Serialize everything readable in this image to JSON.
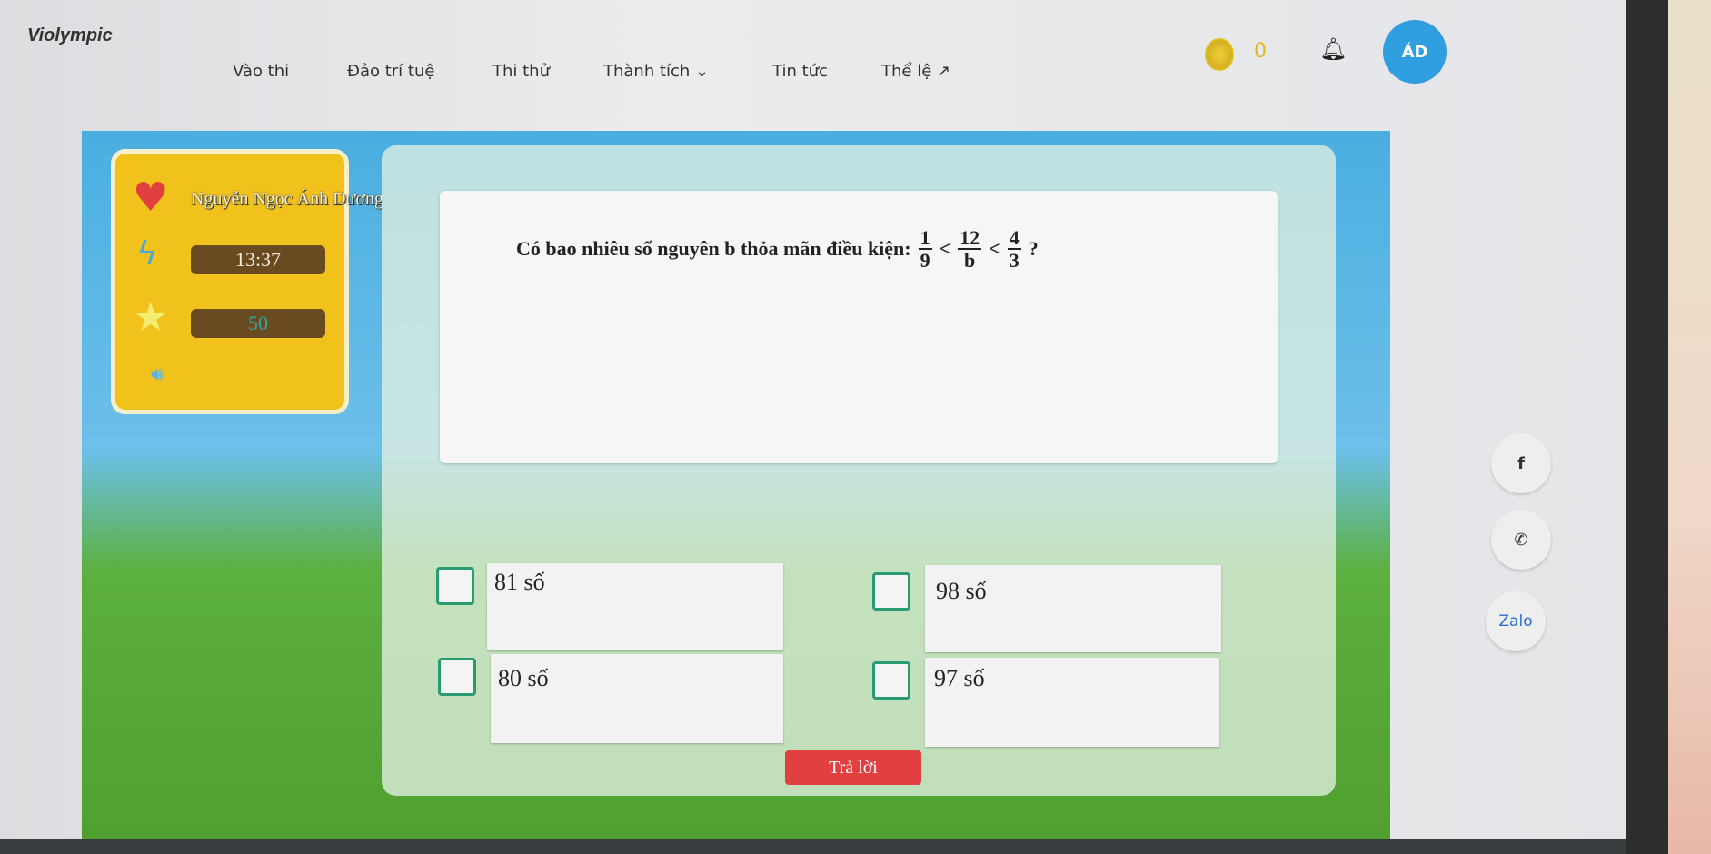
{
  "header": {
    "logo": "Violympic",
    "nav": [
      {
        "label": "Vào thi"
      },
      {
        "label": "Đảo trí tuệ"
      },
      {
        "label": "Thi thử"
      },
      {
        "label": "Thành tích ⌄"
      },
      {
        "label": "Tin tức"
      },
      {
        "label": "Thể lệ ↗"
      }
    ],
    "coins": "0",
    "avatar_initials": "ÁD"
  },
  "player": {
    "name": "Nguyễn Ngọc Ánh Dương",
    "timer": "13:37",
    "score": "50"
  },
  "question": {
    "text": "Có bao nhiêu số nguyên b thỏa mãn điều kiện:",
    "f1": {
      "num": "1",
      "den": "9"
    },
    "f2": {
      "num": "12",
      "den": "b"
    },
    "f3": {
      "num": "4",
      "den": "3"
    },
    "lt": "<",
    "end": "?"
  },
  "answers": [
    {
      "label": "81 số"
    },
    {
      "label": "98 số"
    },
    {
      "label": "80 số"
    },
    {
      "label": "97 số"
    }
  ],
  "submit_label": "Trả lời",
  "social": {
    "facebook": "f",
    "phone": "✆",
    "zalo": "Zalo"
  },
  "colors": {
    "accent": "#2f9fe0",
    "submit": "#e04040",
    "panel": "#f2c21c",
    "checkbox": "#2a9a70"
  }
}
